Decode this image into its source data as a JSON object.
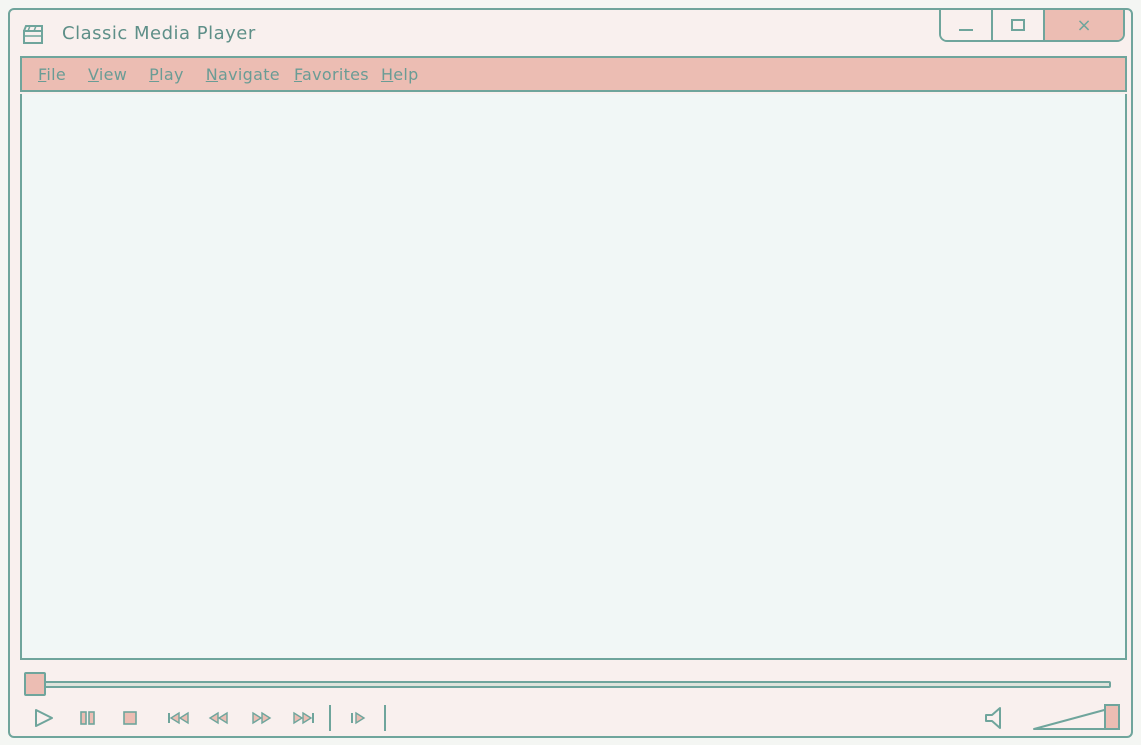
{
  "window": {
    "title": "Classic Media Player",
    "icon": "clapperboard-icon"
  },
  "window_controls": {
    "minimize_icon": "minimize-icon",
    "maximize_icon": "maximize-icon",
    "close_label": "×"
  },
  "menu": {
    "items": [
      {
        "label": "File"
      },
      {
        "label": "View"
      },
      {
        "label": "Play"
      },
      {
        "label": "Navigate"
      },
      {
        "label": "Favorites"
      },
      {
        "label": "Help"
      }
    ]
  },
  "playback": {
    "position_fraction": 0.0,
    "volume_fraction": 1.0
  },
  "controls": {
    "icons": [
      "play-icon",
      "pause-icon",
      "stop-icon",
      "previous-icon",
      "rewind-icon",
      "fast-forward-icon",
      "next-icon",
      "frame-step-icon",
      "speaker-icon"
    ]
  },
  "colors": {
    "accent": "#6fa59c",
    "menu_bg": "#ecbdb3",
    "window_bg": "#f9f0ee",
    "viewport_bg": "#f1f7f6"
  }
}
